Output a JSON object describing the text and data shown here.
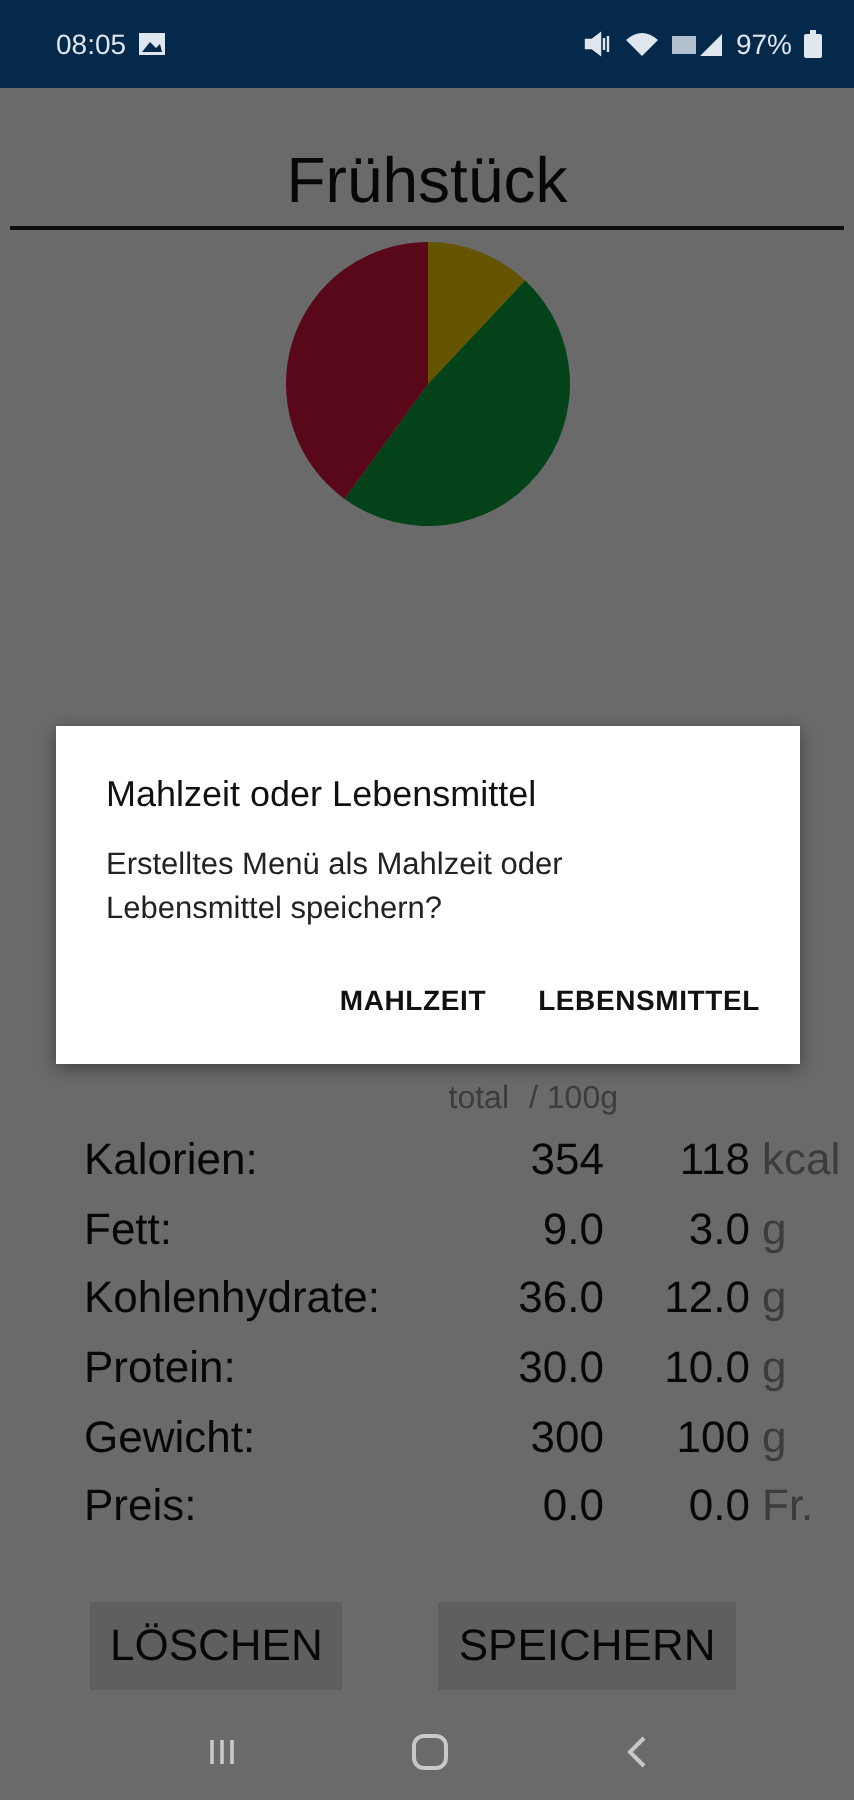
{
  "status_bar": {
    "time": "08:05",
    "battery": "97%"
  },
  "meal_name": {
    "value": "Frühstück"
  },
  "table": {
    "columns": [
      "total",
      "/ 100g"
    ],
    "rows": [
      {
        "label": "Kalorien:",
        "total": "354",
        "per_100g": "118",
        "unit": "kcal"
      },
      {
        "label": "Fett:",
        "total": "9.0",
        "per_100g": "3.0",
        "unit": "g"
      },
      {
        "label": "Kohlenhydrate:",
        "total": "36.0",
        "per_100g": "12.0",
        "unit": "g"
      },
      {
        "label": "Protein:",
        "total": "30.0",
        "per_100g": "10.0",
        "unit": "g"
      },
      {
        "label": "Gewicht:",
        "total": "300",
        "per_100g": "100",
        "unit": "g"
      },
      {
        "label": "Preis:",
        "total": "0.0",
        "per_100g": "0.0",
        "unit": "Fr."
      }
    ]
  },
  "buttons": [
    "LÖSCHEN",
    "SPEICHERN"
  ],
  "dialog": {
    "title": "Mahlzeit oder Lebensmittel",
    "message": "Erstelltes Menü als Mahlzeit oder Lebensmittel speichern?",
    "buttons": [
      "MAHLZEIT",
      "LEBENSMITTEL"
    ]
  }
}
